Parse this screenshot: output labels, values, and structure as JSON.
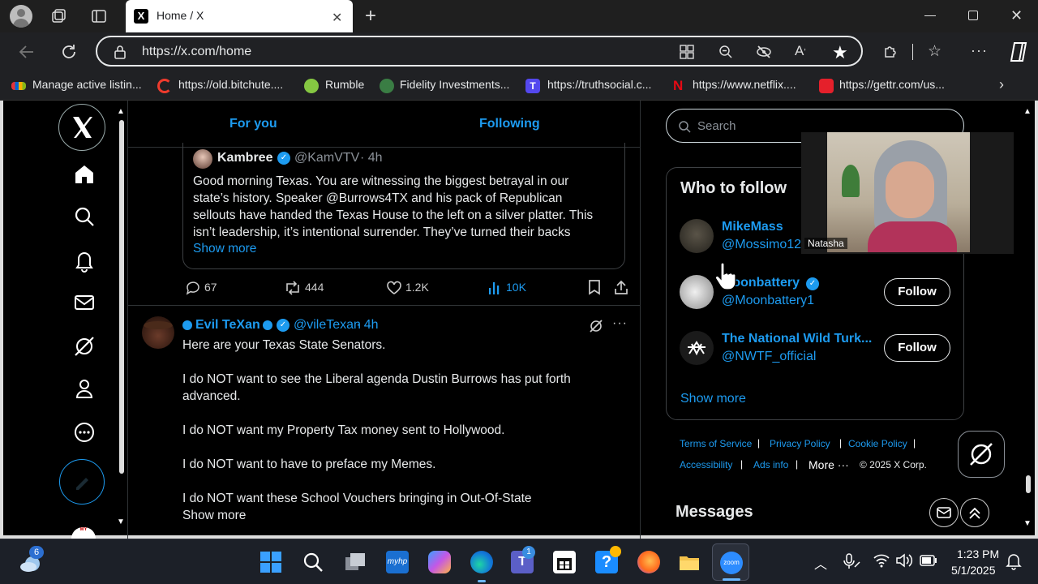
{
  "browser": {
    "tab_title": "Home / X",
    "url": "https://x.com/home",
    "bookmarks": [
      {
        "label": "Manage active listin...",
        "color": "#e53935"
      },
      {
        "label": "https://old.bitchute....",
        "color": "#ef3b2d"
      },
      {
        "label": "Rumble",
        "color": "#85c742"
      },
      {
        "label": "Fidelity Investments...",
        "color": "#3a7d44"
      },
      {
        "label": "https://truthsocial.c...",
        "color": "#5448ee"
      },
      {
        "label": "https://www.netflix....",
        "color": "#e50914"
      },
      {
        "label": "https://gettr.com/us...",
        "color": "#e5202b"
      }
    ]
  },
  "feed": {
    "tabs": [
      "For you",
      "Following"
    ],
    "quoted": {
      "name": "Kambree",
      "handle": "@KamVTV",
      "time": "· 4h",
      "lines": [
        "Good morning Texas. You are witnessing the biggest betrayal in our",
        "state’s history. Speaker @Burrows4TX and his pack of Republican",
        "sellouts have handed the Texas House to the left on a silver platter. This",
        "isn’t leadership, it’s intentional surrender. They’ve turned their backs"
      ],
      "show_more": "Show more"
    },
    "actions": {
      "replies": "67",
      "reposts": "444",
      "likes": "1.2K",
      "views": "10K"
    },
    "tweet": {
      "name": "Evil TeXan",
      "handle": "@vileTexan",
      "time": "· 4h",
      "paragraphs": [
        "Here are your Texas State Senators.",
        "I do NOT want to see the Liberal agenda Dustin Burrows has put forth",
        "advanced.",
        "I do NOT want my Property Tax money sent to Hollywood.",
        "I do NOT want to have to preface my Memes.",
        "I do NOT want these School Vouchers bringing in Out-Of-State"
      ],
      "show_more": "Show more"
    }
  },
  "sidebar": {
    "search_placeholder": "Search",
    "who_to_follow_title": "Who to follow",
    "suggestions": [
      {
        "name": "MikeMass",
        "handle": "@Mossimo122"
      },
      {
        "name": "Moonbattery",
        "handle": "@Moonbattery1",
        "button": "Follow"
      },
      {
        "name": "The National Wild Turk...",
        "handle": "@NWTF_official",
        "button": "Follow"
      }
    ],
    "show_more": "Show more",
    "footer": {
      "terms": "Terms of Service",
      "privacy": "Privacy Policy",
      "cookie": "Cookie Policy",
      "accessibility": "Accessibility",
      "ads": "Ads info",
      "more": "More ···",
      "copyright": "© 2025 X Corp."
    },
    "messages_title": "Messages"
  },
  "webcam": {
    "name": "Natasha"
  },
  "taskbar": {
    "weather_badge": "6",
    "teams_badge": "1",
    "time": "1:23 PM",
    "date": "5/1/2025"
  }
}
